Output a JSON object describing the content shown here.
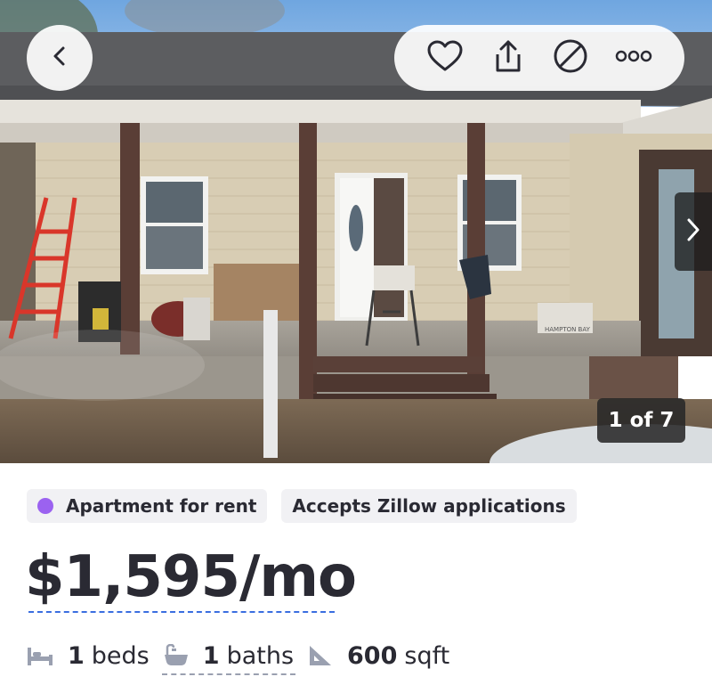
{
  "photo": {
    "counter_text": "1 of 7",
    "box_label": "HAMPTON BAY"
  },
  "nav": {
    "back_icon": "chevron-left-icon",
    "next_icon": "chevron-right-icon",
    "actions": [
      "heart-icon",
      "share-icon",
      "hide-icon",
      "more-icon"
    ]
  },
  "listing": {
    "type_label": "Apartment for rent",
    "type_dot_color": "#9b62f0",
    "applications_label": "Accepts Zillow applications",
    "price": "$1,595/mo",
    "beds_value": "1",
    "beds_unit": "beds",
    "baths_value": "1",
    "baths_unit": "baths",
    "sqft_value": "600",
    "sqft_unit": "sqft"
  },
  "colors": {
    "text": "#2a2a33",
    "link": "#3a6ee0",
    "chip_bg": "#f1f1f4"
  }
}
